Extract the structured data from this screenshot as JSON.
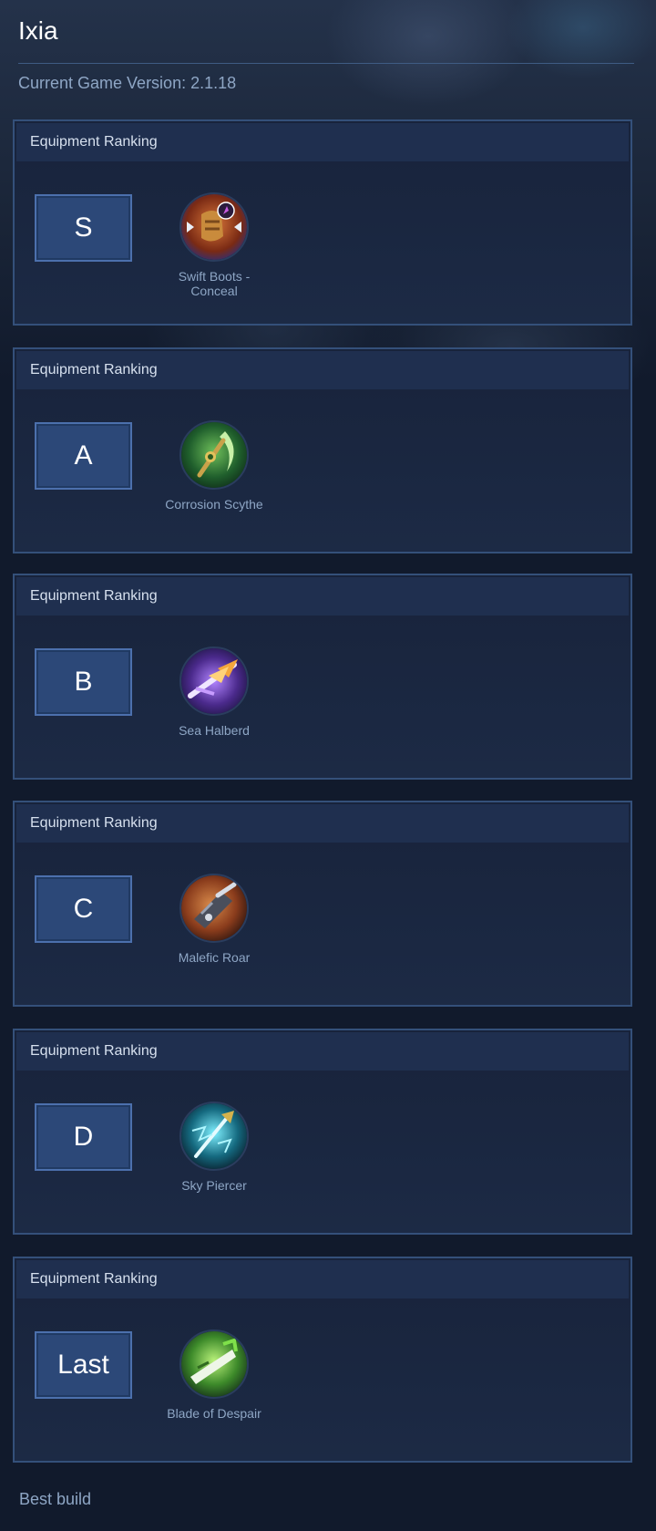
{
  "header": {
    "title": "Ixia",
    "version": "Current Game Version: 2.1.18"
  },
  "rankings": [
    {
      "header": "Equipment Ranking",
      "tier": "S",
      "item_name": "Swift Boots - Conceal",
      "icon": "swift-boots-conceal-icon",
      "icon_color": "#b64a24"
    },
    {
      "header": "Equipment Ranking",
      "tier": "A",
      "item_name": "Corrosion Scythe",
      "icon": "corrosion-scythe-icon",
      "icon_color": "#2f7a3c"
    },
    {
      "header": "Equipment Ranking",
      "tier": "B",
      "item_name": "Sea Halberd",
      "icon": "sea-halberd-icon",
      "icon_color": "#6b3fb4"
    },
    {
      "header": "Equipment Ranking",
      "tier": "C",
      "item_name": "Malefic Roar",
      "icon": "malefic-roar-icon",
      "icon_color": "#a8562a"
    },
    {
      "header": "Equipment Ranking",
      "tier": "D",
      "item_name": "Sky Piercer",
      "icon": "sky-piercer-icon",
      "icon_color": "#1f8ea0"
    },
    {
      "header": "Equipment Ranking",
      "tier": "Last",
      "item_name": "Blade of Despair",
      "icon": "blade-of-despair-icon",
      "icon_color": "#5db33b"
    }
  ],
  "footer": {
    "label": "Best build"
  },
  "colors": {
    "background": "#111a2c",
    "panel_border": "#34507a",
    "tier_box": "#2c4878",
    "muted_text": "#8ea6c5"
  }
}
